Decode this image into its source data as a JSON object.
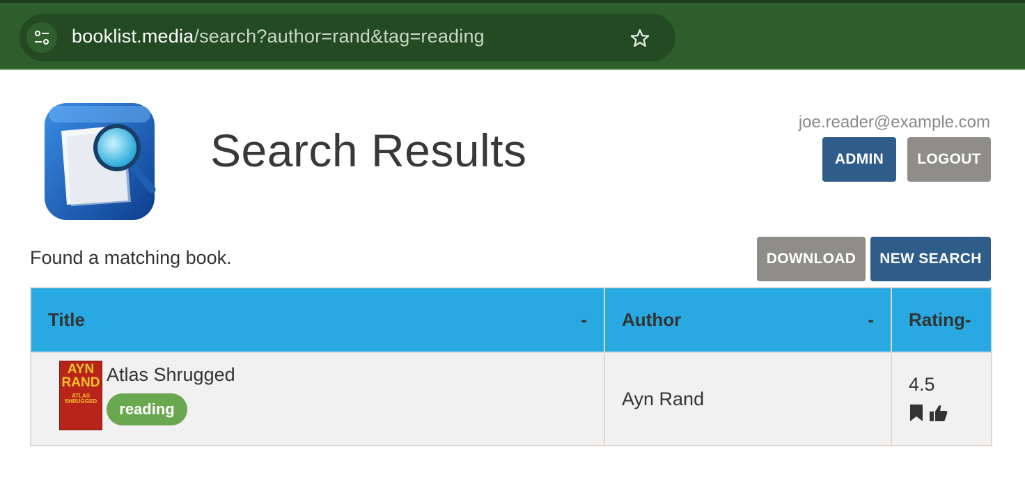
{
  "browser": {
    "url_host": "booklist.media",
    "url_path": "/search?author=rand&tag=reading"
  },
  "header": {
    "title": "Search Results",
    "user_email": "joe.reader@example.com",
    "admin_label": "ADMIN",
    "logout_label": "LOGOUT"
  },
  "toolbar": {
    "status": "Found a matching book.",
    "download_label": "DOWNLOAD",
    "new_search_label": "NEW SEARCH"
  },
  "table": {
    "columns": [
      {
        "label": "Title",
        "sort": "-"
      },
      {
        "label": "Author",
        "sort": "-"
      },
      {
        "label": "Rating-"
      }
    ],
    "rows": [
      {
        "title": "Atlas Shrugged",
        "cover": {
          "line1": "AYN RAND",
          "line2": "ATLAS SHRUGGED"
        },
        "tag": "reading",
        "author": "Ayn Rand",
        "rating": "4.5",
        "icons": [
          "bookmark-icon",
          "thumbs-up-icon"
        ]
      }
    ]
  },
  "colors": {
    "browser_bar": "#2e5e2b",
    "primary_button": "#2f5d8a",
    "secondary_button": "#8f8d88",
    "table_header": "#29a9e1",
    "tag_badge": "#6aa84f"
  }
}
